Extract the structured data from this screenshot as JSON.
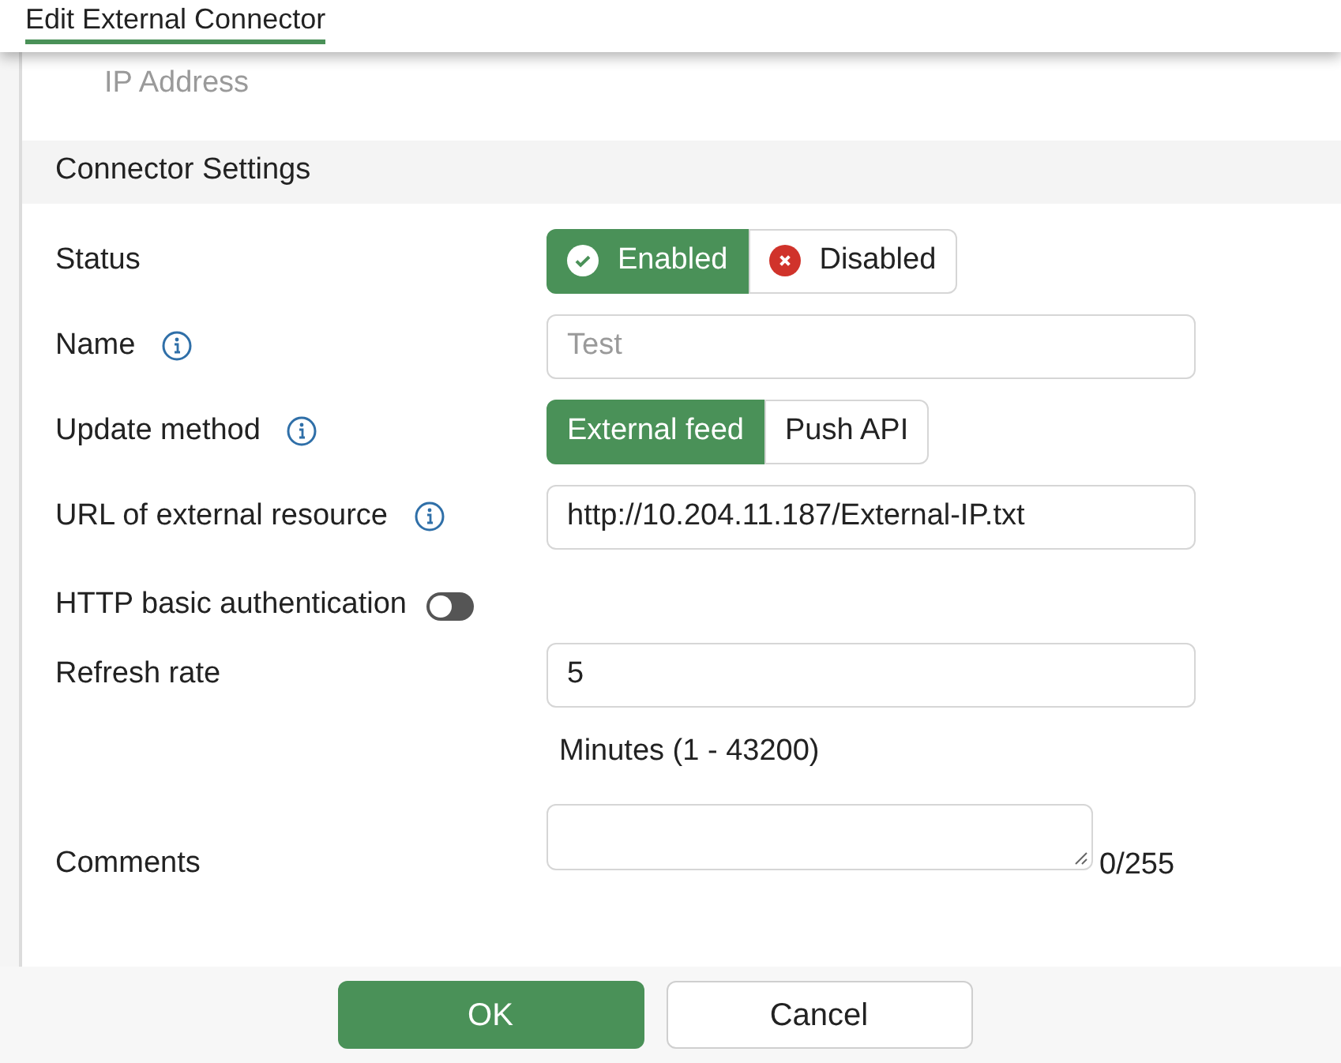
{
  "dialog": {
    "title": "Edit External Connector"
  },
  "previous_field": {
    "label": "IP Address"
  },
  "section": {
    "title": "Connector Settings"
  },
  "fields": [
    {
      "kind": "status",
      "label": "Status",
      "info": false,
      "options": [
        {
          "label": "Enabled",
          "selected": true
        },
        {
          "label": "Disabled",
          "selected": false
        }
      ]
    },
    {
      "kind": "text",
      "label": "Name",
      "info": true,
      "placeholder": "Test"
    },
    {
      "kind": "segmented",
      "label": "Update method",
      "info": true,
      "options": [
        {
          "label": "External feed",
          "selected": true
        },
        {
          "label": "Push API",
          "selected": false
        }
      ]
    },
    {
      "kind": "text",
      "label": "URL of external resource",
      "info": true,
      "value": "http://10.204.11.187/External-IP.txt"
    },
    {
      "kind": "toggle",
      "label": "HTTP basic authentication",
      "on": false
    },
    {
      "kind": "text",
      "label": "Refresh rate",
      "value": "5",
      "hint": "Minutes (1 - 43200)"
    },
    {
      "kind": "textarea",
      "label": "Comments",
      "counter": "0/255"
    }
  ],
  "buttons": [
    {
      "label": "OK",
      "primary": true
    },
    {
      "label": "Cancel",
      "primary": false
    }
  ]
}
